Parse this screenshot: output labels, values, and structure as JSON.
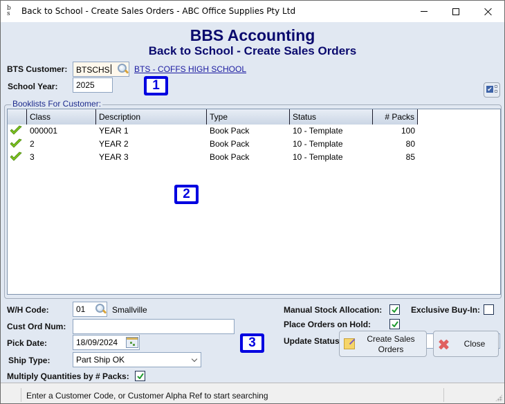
{
  "window": {
    "title": "Back to School - Create Sales Orders - ABC Office Supplies Pty Ltd",
    "app_icon": "bbs-logo-icon",
    "controls": [
      "minimize",
      "maximize",
      "close"
    ]
  },
  "header": {
    "title": "BBS Accounting",
    "subtitle": "Back to School - Create Sales Orders"
  },
  "customer": {
    "label": "BTS Customer:",
    "value": "BTSCHS",
    "lookup_icon": "magnifier-icon",
    "name_link": "BTS - COFFS HIGH SCHOOL"
  },
  "school_year": {
    "label": "School Year:",
    "value": "2025"
  },
  "badges": [
    "1",
    "2",
    "3"
  ],
  "booklists": {
    "legend": "Booklists For Customer:",
    "columns": [
      "",
      "Class",
      "Description",
      "Type",
      "Status",
      "# Packs"
    ],
    "rows": [
      {
        "selected": true,
        "class": "000001",
        "description": "YEAR 1",
        "type": "Book Pack",
        "status": "10 - Template",
        "packs": "100"
      },
      {
        "selected": true,
        "class": "2",
        "description": "YEAR 2",
        "type": "Book Pack",
        "status": "10 - Template",
        "packs": "80"
      },
      {
        "selected": true,
        "class": "3",
        "description": "YEAR 3",
        "type": "Book Pack",
        "status": "10 - Template",
        "packs": "85"
      }
    ]
  },
  "options": {
    "wh_code_label": "W/H Code:",
    "wh_code_value": "01",
    "wh_name": "Smallville",
    "cust_ord_label": "Cust Ord Num:",
    "cust_ord_value": "",
    "pick_date_label": "Pick Date:",
    "pick_date_value": "18/09/2024",
    "ship_type_label": "Ship Type:",
    "ship_type_value": "Part Ship OK",
    "multiply_label": "Multiply Quantities by # Packs:",
    "multiply_checked": true,
    "manual_stock_label": "Manual Stock Allocation:",
    "manual_stock_checked": true,
    "exclusive_label": "Exclusive Buy-In:",
    "exclusive_checked": false,
    "hold_label": "Place Orders on Hold:",
    "hold_checked": true,
    "update_status_label": "Update Status:",
    "update_status_value": ""
  },
  "buttons": {
    "create_label": "Create Sales Orders",
    "close_label": "Close"
  },
  "status_bar": {
    "message": "Enter a Customer Code, or Customer Alpha Ref to start searching"
  },
  "colors": {
    "header_text": "#0a0a6e",
    "badge": "#0000e0",
    "background": "#e1e8f2",
    "check_green": "#7cc21e"
  }
}
